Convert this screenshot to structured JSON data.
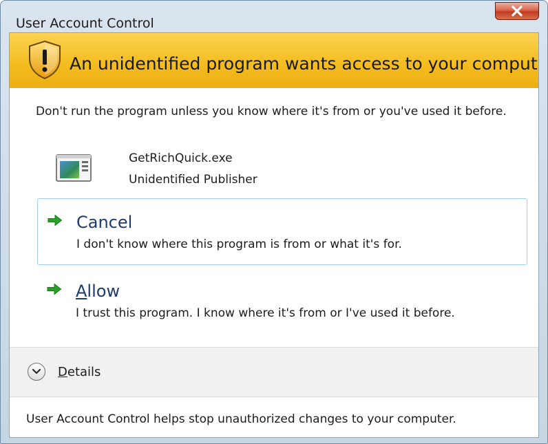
{
  "window": {
    "title": "User Account Control"
  },
  "banner": {
    "heading": "An unidentified program wants access to your computer"
  },
  "body": {
    "warning": "Don't run the program unless you know where it's from or you've used it before."
  },
  "program": {
    "name": "GetRichQuick.exe",
    "publisher": "Unidentified Publisher"
  },
  "options": {
    "cancel": {
      "label_first": "",
      "label_rest": "Cancel",
      "description": "I don't know where this program is from or what it's for."
    },
    "allow": {
      "label_first": "A",
      "label_rest": "llow",
      "description": "I trust this program. I know where it's from or I've used it before."
    }
  },
  "details": {
    "label_first": "D",
    "label_rest": "etails"
  },
  "footer": {
    "text": "User Account Control helps stop unauthorized changes to your computer."
  },
  "icons": {
    "close": "close-icon",
    "shield": "shield-warning-icon",
    "program": "program-icon",
    "arrow": "green-arrow-icon",
    "chevron": "chevron-down-icon"
  },
  "colors": {
    "banner": "#f4bd21",
    "option_title": "#1f3a6e",
    "arrow": "#2aa02a",
    "close": "#c03b21",
    "focus_border": "#9fd2ea"
  }
}
